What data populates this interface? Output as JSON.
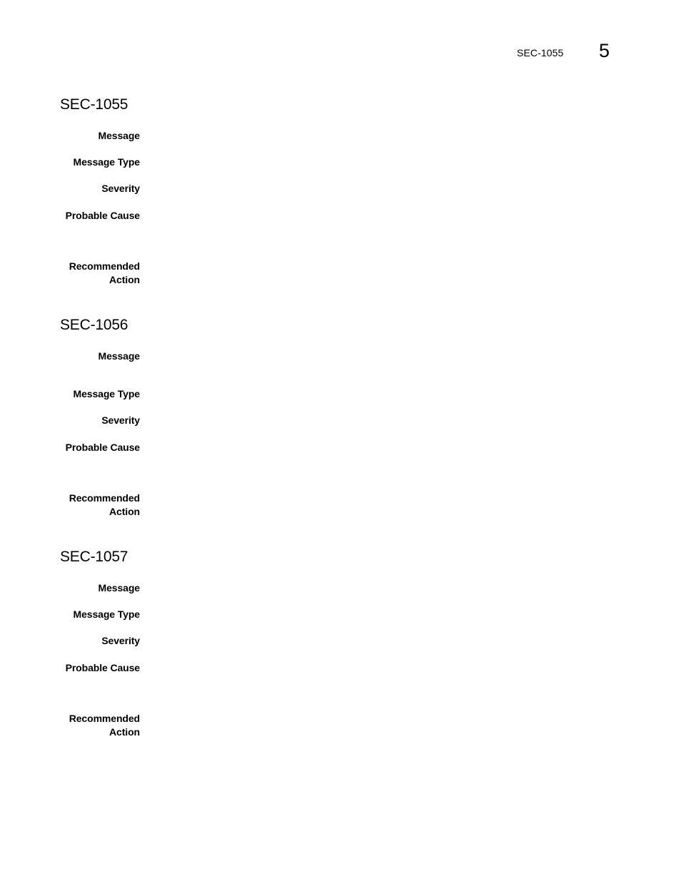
{
  "running_header": {
    "title": "SEC-1055",
    "chapter_number": "5"
  },
  "sections": [
    {
      "id": "SEC-1055",
      "fields": [
        {
          "label": "Message",
          "value": ""
        },
        {
          "label": "Message Type",
          "value": ""
        },
        {
          "label": "Severity",
          "value": ""
        },
        {
          "label": "Probable Cause",
          "value": ""
        },
        {
          "label": "Recommended Action",
          "value": ""
        }
      ]
    },
    {
      "id": "SEC-1056",
      "fields": [
        {
          "label": "Message",
          "value": ""
        },
        {
          "label": "Message Type",
          "value": ""
        },
        {
          "label": "Severity",
          "value": ""
        },
        {
          "label": "Probable Cause",
          "value": ""
        },
        {
          "label": "Recommended Action",
          "value": ""
        }
      ]
    },
    {
      "id": "SEC-1057",
      "fields": [
        {
          "label": "Message",
          "value": ""
        },
        {
          "label": "Message Type",
          "value": ""
        },
        {
          "label": "Severity",
          "value": ""
        },
        {
          "label": "Probable Cause",
          "value": ""
        },
        {
          "label": "Recommended Action",
          "value": ""
        }
      ]
    }
  ]
}
